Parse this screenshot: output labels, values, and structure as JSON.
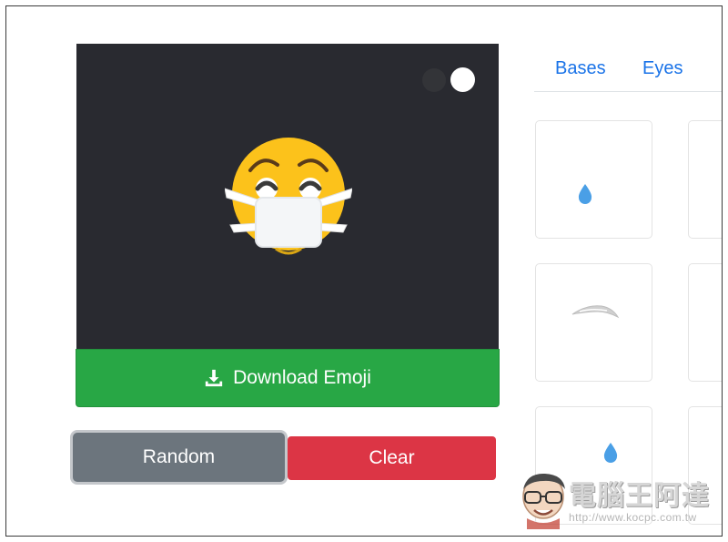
{
  "preview": {
    "background_color": "#292a30",
    "toggles": [
      {
        "name": "dark-background-toggle",
        "color": "#333438"
      },
      {
        "name": "light-background-toggle",
        "color": "#ffffff"
      }
    ],
    "emoji_icon": "face-with-medical-mask-icon"
  },
  "actions": {
    "download_label": "Download Emoji",
    "download_icon": "download-icon",
    "random_label": "Random",
    "clear_label": "Clear"
  },
  "tabs": [
    {
      "label": "Bases"
    },
    {
      "label": "Eyes"
    }
  ],
  "parts_grid": [
    {
      "icon": "teardrop-icon"
    },
    {
      "icon": "eyebrow-icon"
    },
    {
      "icon": "teardrop-icon"
    }
  ],
  "watermark": {
    "title": "電腦王阿達",
    "url": "http://www.kocpc.com.tw"
  },
  "colors": {
    "download": "#28a745",
    "random": "#6c757d",
    "clear": "#dc3545",
    "tab_link": "#1a73e8"
  }
}
